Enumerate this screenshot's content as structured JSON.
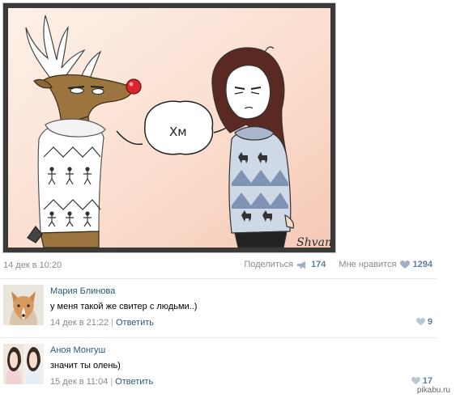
{
  "post": {
    "image_signature": "Shvan",
    "speech_bubble_text": "Хм",
    "date": "14 дек в 10:20",
    "share_label": "Поделиться",
    "share_count": "174",
    "like_label": "Мне нравится",
    "like_count": "1294"
  },
  "comments": [
    {
      "author": "Мария Блинова",
      "text": "у меня такой же свитер с людьми..)",
      "date": "14 дек в 21:22",
      "reply_label": "Ответить",
      "likes": "9"
    },
    {
      "author": "Аноя Монгуш",
      "text": "значит ты олень)",
      "date": "15 дек в 11:04",
      "reply_label": "Ответить",
      "likes": "17"
    }
  ],
  "watermark": "pikabu.ru",
  "colors": {
    "link": "#2b587a",
    "count": "#5f7fa3",
    "muted": "#8a8a8a",
    "sweater_blue": "#7f93b5"
  },
  "icons": [
    "share-megaphone-icon",
    "heart-icon"
  ]
}
